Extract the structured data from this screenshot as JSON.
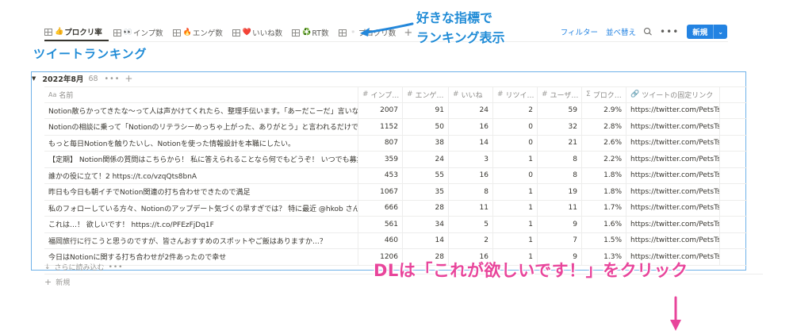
{
  "views": {
    "tabs": [
      {
        "emoji": "👍",
        "label": "プロクリ率",
        "active": true
      },
      {
        "emoji": "👀",
        "label": "インプ数",
        "active": false
      },
      {
        "emoji": "🔥",
        "label": "エンゲ数",
        "active": false
      },
      {
        "emoji": "❤️",
        "label": "いいね数",
        "active": false
      },
      {
        "emoji": "♻️",
        "label": "RT数",
        "active": false
      },
      {
        "emoji": "▫️",
        "label": "プロクリ数",
        "active": false
      }
    ],
    "add_icon": "plus-icon"
  },
  "toolbar": {
    "filter_label": "フィルター",
    "sort_label": "並べ替え",
    "search_icon": "search-icon",
    "more_label": "•••",
    "new_label": "新規",
    "new_chevron": "⌄",
    "accent_color": "#2383e2"
  },
  "annotations": {
    "top_line1": "好きな指標で",
    "top_line2": "ランキング表示",
    "title": "ツイートランキング",
    "dl_text": "DLは「これが欲しいです！」をクリック",
    "blue_color": "#1f8bd6",
    "pink_color": "#e8459b"
  },
  "group": {
    "toggle": "▼",
    "name": "2022年8月",
    "count": "68",
    "more": "•••",
    "add": "+"
  },
  "table": {
    "columns": [
      {
        "icon": "Aa",
        "label": "名前"
      },
      {
        "icon": "#",
        "label": "インプ…"
      },
      {
        "icon": "#",
        "label": "エンゲ…"
      },
      {
        "icon": "#",
        "label": "いいね"
      },
      {
        "icon": "#",
        "label": "リツイ…"
      },
      {
        "icon": "#",
        "label": "ユーザ…"
      },
      {
        "icon": "Σ",
        "label": "プロク…"
      },
      {
        "icon": "🔗",
        "label": "ツイートの固定リンク"
      },
      {
        "icon": "",
        "label": ""
      }
    ],
    "rows": [
      {
        "name": "Notion散らかってきたな〜って人は声かけてくれたら、整理手伝います。「あーだこーだ」言いながら、",
        "imp": "2007",
        "eng": "91",
        "like": "24",
        "rt": "2",
        "user": "59",
        "rate": "2.9%",
        "link": "https://twitter.com/PetsTsubas"
      },
      {
        "name": "Notionの相談に乗って「Notionのリテラシーめっちゃ上がった、ありがとう」と言われるだけでうれしい",
        "imp": "1152",
        "eng": "50",
        "like": "16",
        "rt": "0",
        "user": "32",
        "rate": "2.8%",
        "link": "https://twitter.com/PetsTsubas"
      },
      {
        "name": "もっと毎日Notionを触りたいし、Notionを使った情報設計を本職にしたい。",
        "imp": "807",
        "eng": "38",
        "like": "14",
        "rt": "0",
        "user": "21",
        "rate": "2.6%",
        "link": "https://twitter.com/PetsTsubas"
      },
      {
        "name": "【定期】 Notion関係の質問はこちらから！ 私に答えられることなら何でもどうぞ！ いつでも募集中です",
        "imp": "359",
        "eng": "24",
        "like": "3",
        "rt": "1",
        "user": "8",
        "rate": "2.2%",
        "link": "https://twitter.com/PetsTsubas"
      },
      {
        "name": "誰かの役に立て！2 https://t.co/vzqQts8bnA",
        "imp": "453",
        "eng": "55",
        "like": "16",
        "rt": "0",
        "user": "8",
        "rate": "1.8%",
        "link": "https://twitter.com/PetsTsubas"
      },
      {
        "name": "昨日も今日も朝イチでNotion関連の打ち合わせできたので満足",
        "imp": "1067",
        "eng": "35",
        "like": "8",
        "rt": "1",
        "user": "19",
        "rate": "1.8%",
        "link": "https://twitter.com/PetsTsubas"
      },
      {
        "name": "私のフォローしている方々、Notionのアップデート気づくの早すぎでは？ 特に最近 @hkob さんが早い",
        "imp": "666",
        "eng": "28",
        "like": "11",
        "rt": "1",
        "user": "11",
        "rate": "1.7%",
        "link": "https://twitter.com/PetsTsubas"
      },
      {
        "name": "これは…！ 欲しいです！ https://t.co/PFEzFjDq1F",
        "imp": "561",
        "eng": "34",
        "like": "5",
        "rt": "1",
        "user": "9",
        "rate": "1.6%",
        "link": "https://twitter.com/PetsTsubas"
      },
      {
        "name": "福岡旅行に行こうと思うのですが、皆さんおすすめのスポットやご飯はありますか…？",
        "imp": "460",
        "eng": "14",
        "like": "2",
        "rt": "1",
        "user": "7",
        "rate": "1.5%",
        "link": "https://twitter.com/PetsTsubas"
      },
      {
        "name": "今日はNotionに関する打ち合わせが2件あったので幸せ",
        "imp": "1206",
        "eng": "28",
        "like": "16",
        "rt": "1",
        "user": "9",
        "rate": "1.3%",
        "link": "https://twitter.com/PetsTsubas"
      }
    ],
    "load_more": "さらに読み込む",
    "load_more_arrow": "↓",
    "load_more_dots": "•••",
    "new_row_plus": "+",
    "new_row_label": "新規"
  }
}
